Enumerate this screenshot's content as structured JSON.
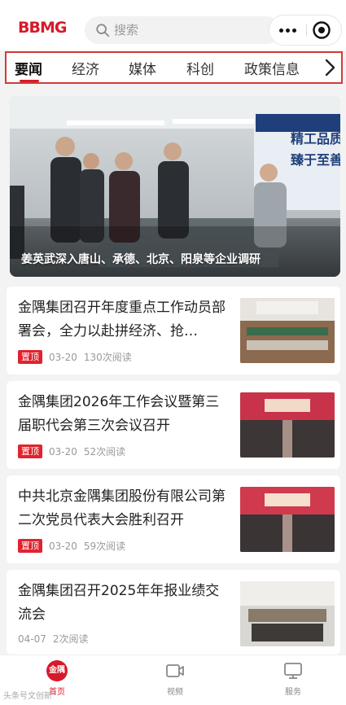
{
  "header": {
    "logo_text": "BBMG",
    "search_placeholder": "搜索",
    "more_icon": "more-dots-icon",
    "target_icon": "target-icon"
  },
  "tabs": [
    {
      "label": "要闻",
      "active": true
    },
    {
      "label": "经济"
    },
    {
      "label": "媒体"
    },
    {
      "label": "科创"
    },
    {
      "label": "政策信息"
    }
  ],
  "hero": {
    "caption": "姜英武深入唐山、承德、北京、阳泉等企业调研",
    "banner_text_1": "精工品质",
    "banner_text_2": "臻于至善"
  },
  "news": [
    {
      "title": "金隅集团召开年度重点工作动员部署会，全力以赴拼经济、抢…",
      "pinned": true,
      "pin_label": "置顶",
      "date": "03-20",
      "reads": "130次阅读"
    },
    {
      "title": "金隅集团2026年工作会议暨第三届职代会第三次会议召开",
      "pinned": true,
      "pin_label": "置顶",
      "date": "03-20",
      "reads": "52次阅读"
    },
    {
      "title": "中共北京金隅集团股份有限公司第二次党员代表大会胜利召开",
      "pinned": true,
      "pin_label": "置顶",
      "date": "03-20",
      "reads": "59次阅读"
    },
    {
      "title": "金隅集团召开2025年年报业绩交流会",
      "pinned": false,
      "date": "04-07",
      "reads": "2次阅读"
    }
  ],
  "bottom_nav": [
    {
      "label": "首页",
      "icon": "home-logo-icon",
      "active": true,
      "icon_text": "金隅"
    },
    {
      "label": "视频",
      "icon": "video-icon"
    },
    {
      "label": "服务",
      "icon": "monitor-icon"
    }
  ],
  "watermark": "头条号文创新"
}
